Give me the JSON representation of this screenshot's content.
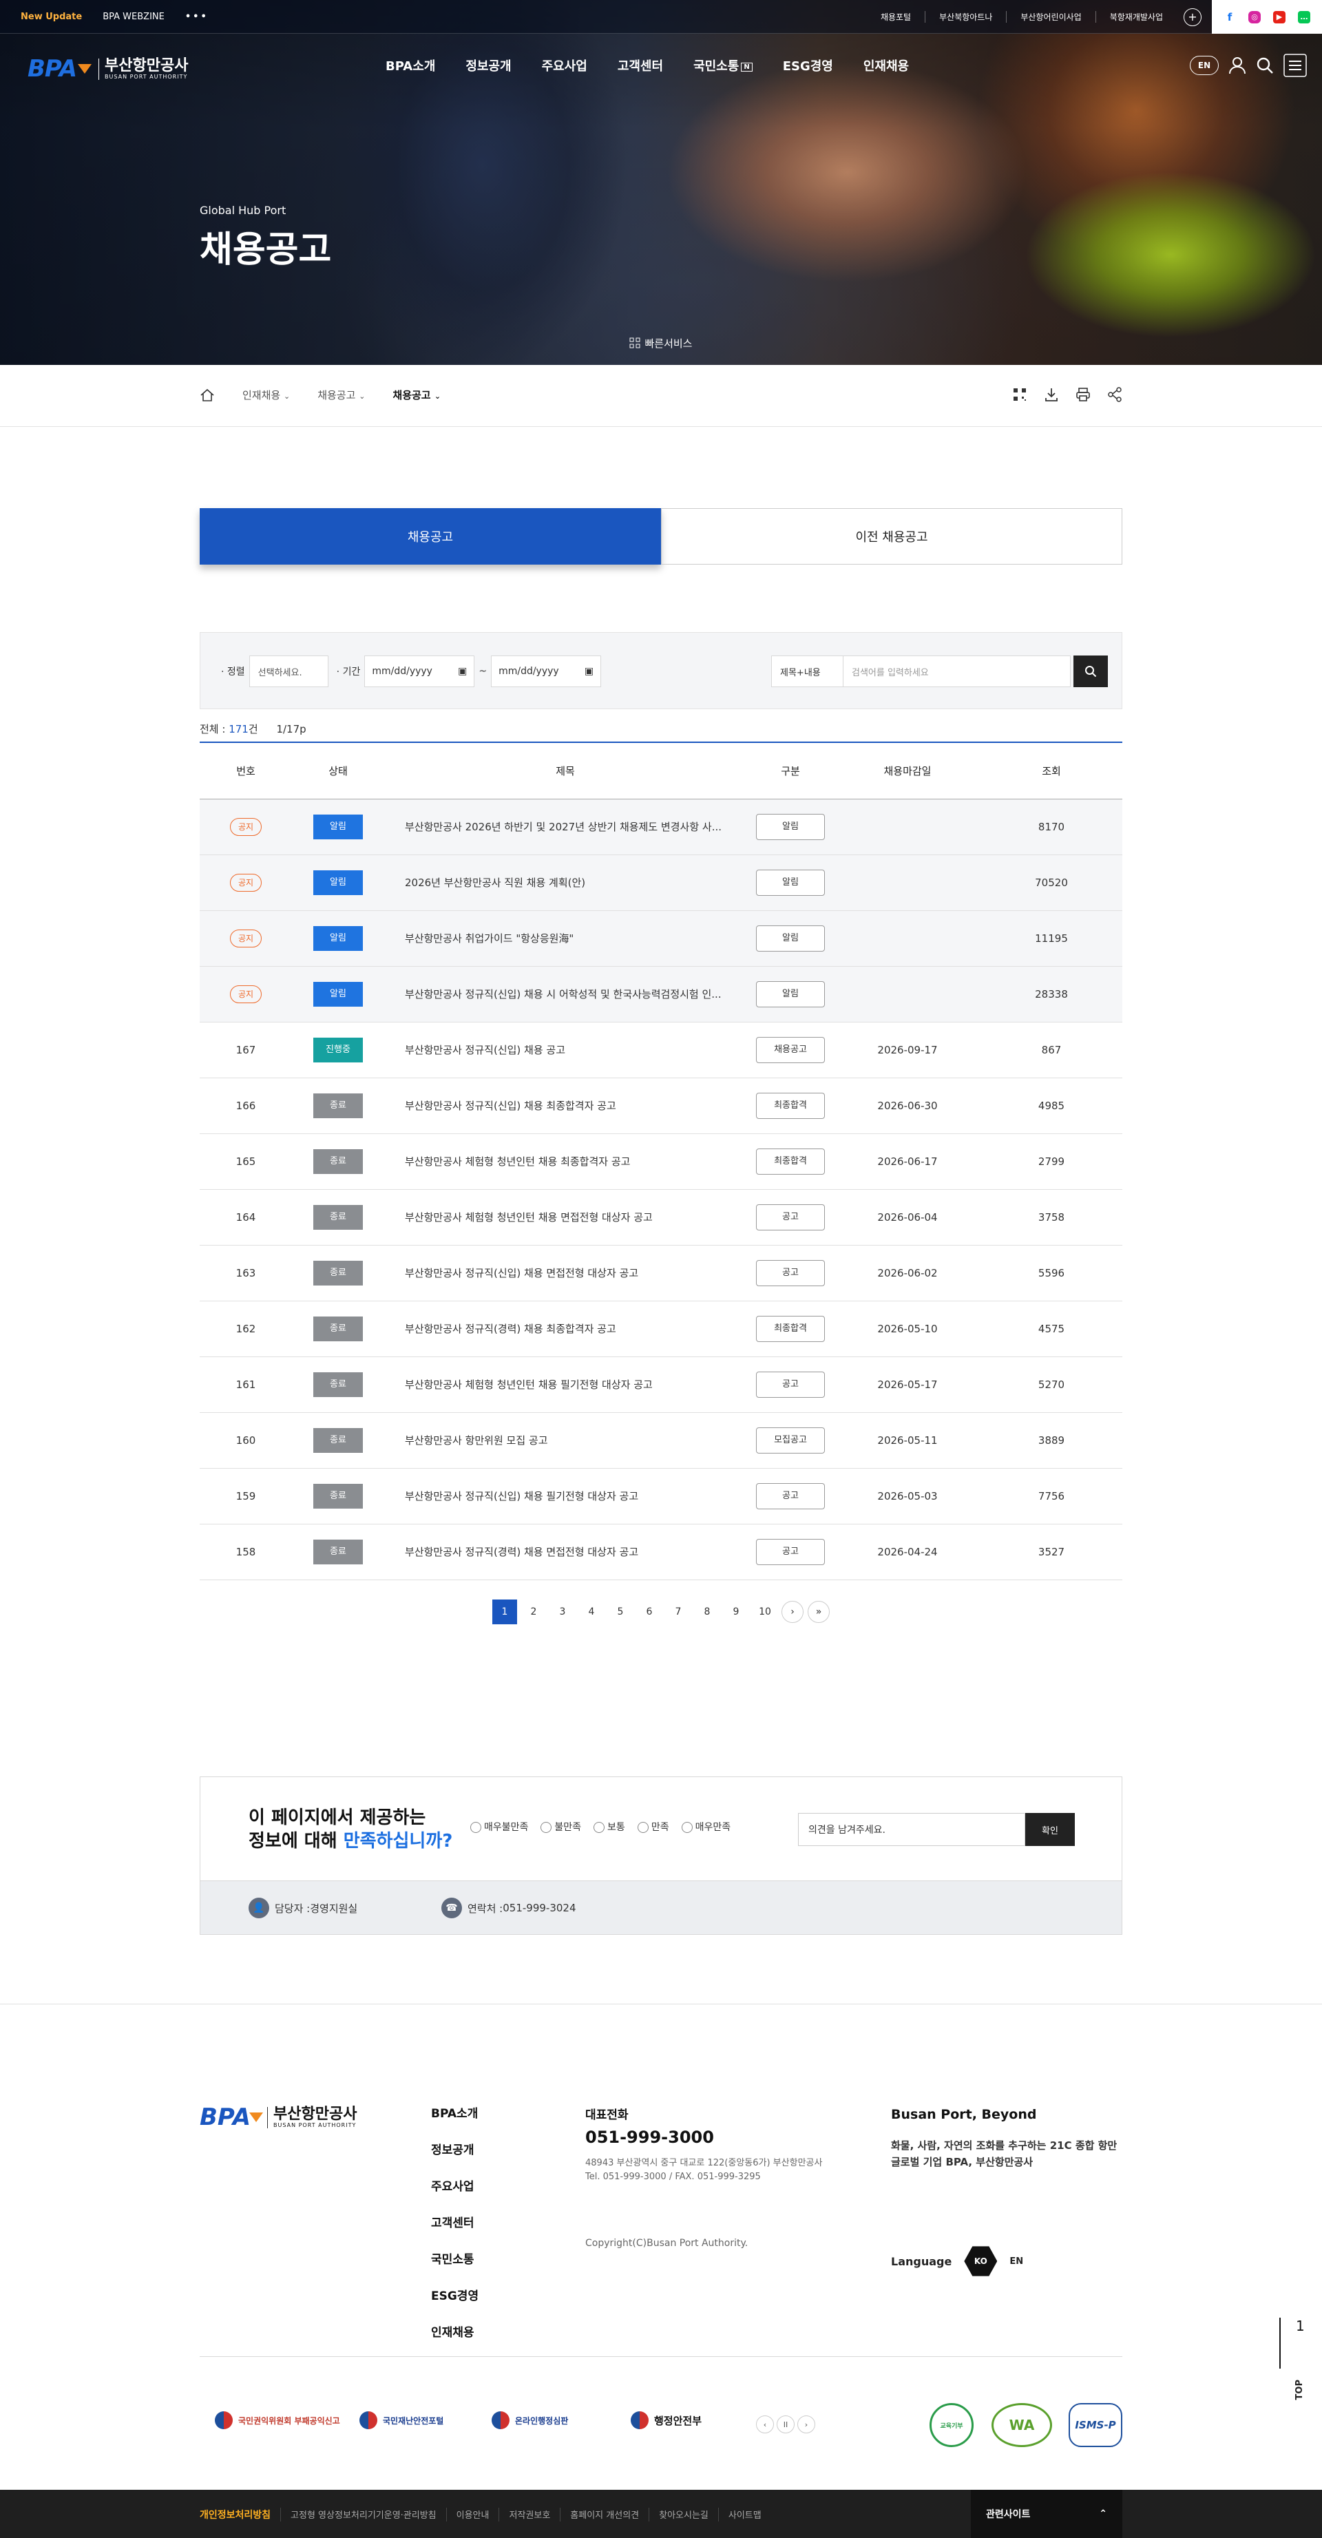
{
  "topbar": {
    "new_update": "New Update",
    "webzine": "BPA WEBZINE",
    "more": "•••",
    "links": [
      "채용포털",
      "부산북항아트나",
      "부산항어린이사업",
      "북항재개발사업"
    ]
  },
  "nav": {
    "logo_en": "BPA",
    "logo_ko": "부산항만공사",
    "logo_sub": "BUSAN PORT AUTHORITY",
    "menu": [
      "BPA소개",
      "정보공개",
      "주요사업",
      "고객센터",
      "국민소통",
      "ESG경영",
      "인재채용"
    ],
    "menu_badge": "N",
    "lang_btn": "EN"
  },
  "hero": {
    "subtitle": "Global Hub Port",
    "title": "채용공고",
    "quick_service": "빠른서비스"
  },
  "breadcrumb": [
    "인재채용",
    "채용공고",
    "채용공고"
  ],
  "tabs": [
    "채용공고",
    "이전 채용공고"
  ],
  "search": {
    "sort_label": "· 정렬",
    "sort_value": "선택하세요.",
    "period_label": "· 기간",
    "date_from": "mm/dd/yyyy",
    "date_sep": "~",
    "date_to": "mm/dd/yyyy",
    "key_value": "제목+내용",
    "placeholder": "검색어를 입력하세요"
  },
  "count": {
    "label": "전체 : ",
    "total": "171",
    "unit": "건",
    "page": "1/17p"
  },
  "table": {
    "headers": [
      "번호",
      "상태",
      "제목",
      "구분",
      "채용마감일",
      "조회"
    ],
    "rows": [
      {
        "no": "공지",
        "status": "알림",
        "status_type": "alarm",
        "title": "부산항만공사 2026년 하반기 및 2027년 상반기 채용제도 변경사항 사...",
        "category": "알림",
        "deadline": "",
        "views": "8170",
        "notice": true
      },
      {
        "no": "공지",
        "status": "알림",
        "status_type": "alarm",
        "title": "2026년 부산항만공사 직원 채용 계획(안)",
        "category": "알림",
        "deadline": "",
        "views": "70520",
        "notice": true
      },
      {
        "no": "공지",
        "status": "알림",
        "status_type": "alarm",
        "title": "부산항만공사 취업가이드 \"항상응원海\"",
        "category": "알림",
        "deadline": "",
        "views": "11195",
        "notice": true
      },
      {
        "no": "공지",
        "status": "알림",
        "status_type": "alarm",
        "title": "부산항만공사 정규직(신입) 채용 시 어학성적 및 한국사능력검정시험 인...",
        "category": "알림",
        "deadline": "",
        "views": "28338",
        "notice": true
      },
      {
        "no": "167",
        "status": "진행중",
        "status_type": "prog",
        "title": "부산항만공사 정규직(신입) 채용 공고",
        "category": "채용공고",
        "deadline": "2026-09-17",
        "views": "867",
        "notice": false
      },
      {
        "no": "166",
        "status": "종료",
        "status_type": "end",
        "title": "부산항만공사 정규직(신입) 채용 최종합격자 공고",
        "category": "최종합격",
        "deadline": "2026-06-30",
        "views": "4985",
        "notice": false
      },
      {
        "no": "165",
        "status": "종료",
        "status_type": "end",
        "title": "부산항만공사 체험형 청년인턴 채용 최종합격자 공고",
        "category": "최종합격",
        "deadline": "2026-06-17",
        "views": "2799",
        "notice": false
      },
      {
        "no": "164",
        "status": "종료",
        "status_type": "end",
        "title": "부산항만공사 체험형 청년인턴 채용 면접전형 대상자 공고",
        "category": "공고",
        "deadline": "2026-06-04",
        "views": "3758",
        "notice": false
      },
      {
        "no": "163",
        "status": "종료",
        "status_type": "end",
        "title": "부산항만공사 정규직(신입) 채용 면접전형 대상자 공고",
        "category": "공고",
        "deadline": "2026-06-02",
        "views": "5596",
        "notice": false
      },
      {
        "no": "162",
        "status": "종료",
        "status_type": "end",
        "title": "부산항만공사 정규직(경력) 채용 최종합격자 공고",
        "category": "최종합격",
        "deadline": "2026-05-10",
        "views": "4575",
        "notice": false
      },
      {
        "no": "161",
        "status": "종료",
        "status_type": "end",
        "title": "부산항만공사 체험형 청년인턴 채용 필기전형 대상자 공고",
        "category": "공고",
        "deadline": "2026-05-17",
        "views": "5270",
        "notice": false
      },
      {
        "no": "160",
        "status": "종료",
        "status_type": "end",
        "title": "부산항만공사 항만위원 모집 공고",
        "category": "모집공고",
        "deadline": "2026-05-11",
        "views": "3889",
        "notice": false
      },
      {
        "no": "159",
        "status": "종료",
        "status_type": "end",
        "title": "부산항만공사 정규직(신입) 채용 필기전형 대상자 공고",
        "category": "공고",
        "deadline": "2026-05-03",
        "views": "7756",
        "notice": false
      },
      {
        "no": "158",
        "status": "종료",
        "status_type": "end",
        "title": "부산항만공사 정규직(경력) 채용 면접전형 대상자 공고",
        "category": "공고",
        "deadline": "2026-04-24",
        "views": "3527",
        "notice": false
      }
    ]
  },
  "pagination": {
    "pages": [
      "1",
      "2",
      "3",
      "4",
      "5",
      "6",
      "7",
      "8",
      "9",
      "10"
    ],
    "current": "1",
    "next": "›",
    "last": "»"
  },
  "survey": {
    "q1": "이 페이지에서 제공하는",
    "q2a": "정보에 대해 ",
    "q2b": "만족하십니까?",
    "options": [
      "매우불만족",
      "불만족",
      "보통",
      "만족",
      "매우만족"
    ],
    "input_value": "의견을 남겨주세요.",
    "submit": "확인",
    "manager_label": "담당자 : ",
    "manager": "경영지원실",
    "contact_label": "연락처 : ",
    "contact": "051-999-3024"
  },
  "footer": {
    "logo_en": "BPA",
    "logo_ko": "부산항만공사",
    "logo_sub": "BUSAN PORT AUTHORITY",
    "menu": [
      "BPA소개",
      "정보공개",
      "주요사업",
      "고객센터",
      "국민소통",
      "ESG경영",
      "인재채용"
    ],
    "phone_label": "대표전화",
    "phone": "051-999-3000",
    "addr1": "48943 부산광역시 중구 대교로 122(중앙동6가) 부산항만공사",
    "addr2": "Tel. 051-999-3000 / FAX. 051-999-3295",
    "copyright": "Copyright(C)Busan Port Authority.",
    "slogan_title": "Busan Port, Beyond",
    "slogan_desc1": "화물, 사람, 자연의 조화를 추구하는 21C 종합 항만",
    "slogan_desc2": "글로벌 기업 BPA, 부산항만공사",
    "language_label": "Language",
    "lang_ko": "KO",
    "lang_en": "EN",
    "banners": [
      "국민권익위원회 부패공익신고",
      "국민재난안전포털",
      "온라인행정심판",
      "행정안전부"
    ],
    "banner_page": "II",
    "certs": [
      "교육기부",
      "WA",
      "ISMS-P"
    ],
    "top": "TOP",
    "top_num": "1"
  },
  "bottom": {
    "links": [
      "개인정보처리방침",
      "고정형 영상정보처리기기운영·관리방침",
      "이용안내",
      "저작권보호",
      "홈페이지 개선의견",
      "찾아오시는길",
      "사이트맵"
    ],
    "related": "관련사이트"
  }
}
